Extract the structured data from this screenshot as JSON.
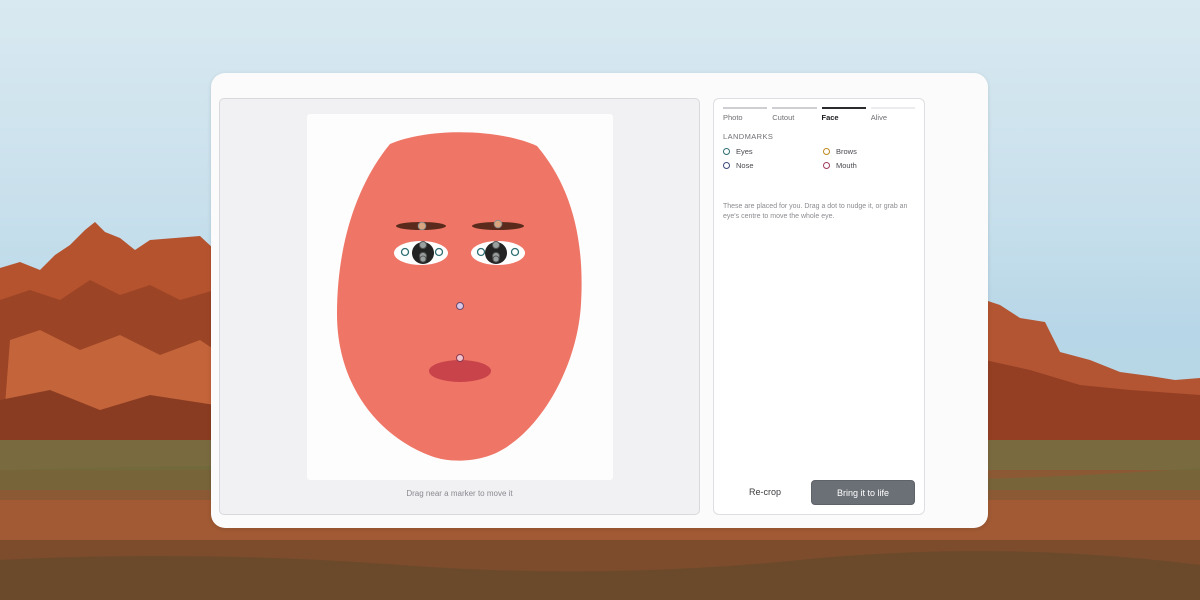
{
  "tabs": [
    {
      "label": "Photo",
      "state": "done"
    },
    {
      "label": "Cutout",
      "state": "done"
    },
    {
      "label": "Face",
      "state": "active"
    },
    {
      "label": "Alive",
      "state": "todo"
    }
  ],
  "landmarks": {
    "title": "LANDMARKS",
    "items": [
      {
        "label": "Eyes",
        "color": "#2e6e72"
      },
      {
        "label": "Brows",
        "color": "#c08a1e"
      },
      {
        "label": "Nose",
        "color": "#3c4a7a"
      },
      {
        "label": "Mouth",
        "color": "#a03c5a"
      }
    ],
    "help": "These are placed for you. Drag a dot to nudge it, or grab an eye's centre to move the whole eye."
  },
  "canvas": {
    "hint": "Drag near a marker to move it",
    "face_color": "#ef7666",
    "mouth_color": "#c9434a",
    "brow_color": "#5a2b1c"
  },
  "buttons": {
    "recrop": "Re-crop",
    "primary": "Bring it to life"
  }
}
